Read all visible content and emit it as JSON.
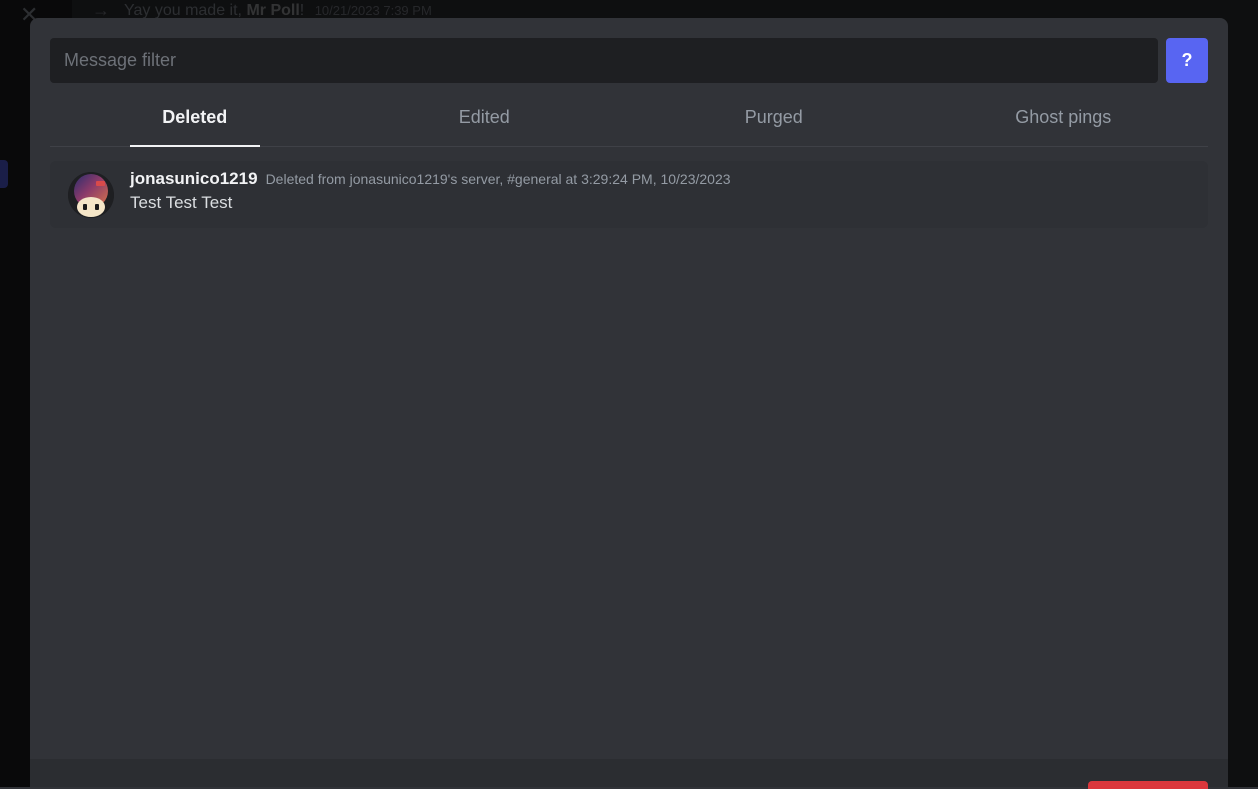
{
  "background": {
    "message_prefix": "Yay you made it, ",
    "message_bold": "Mr Poll",
    "message_suffix": "!",
    "timestamp": "10/21/2023 7:39 PM"
  },
  "filter": {
    "placeholder": "Message filter"
  },
  "help": {
    "label": "?"
  },
  "tabs": {
    "items": [
      {
        "label": "Deleted",
        "active": true
      },
      {
        "label": "Edited",
        "active": false
      },
      {
        "label": "Purged",
        "active": false
      },
      {
        "label": "Ghost pings",
        "active": false
      }
    ]
  },
  "messages": [
    {
      "username": "jonasunico1219",
      "meta": "Deleted from jonasunico1219's server, #general at 3:29:24 PM, 10/23/2023",
      "content": "Test Test Test"
    }
  ]
}
